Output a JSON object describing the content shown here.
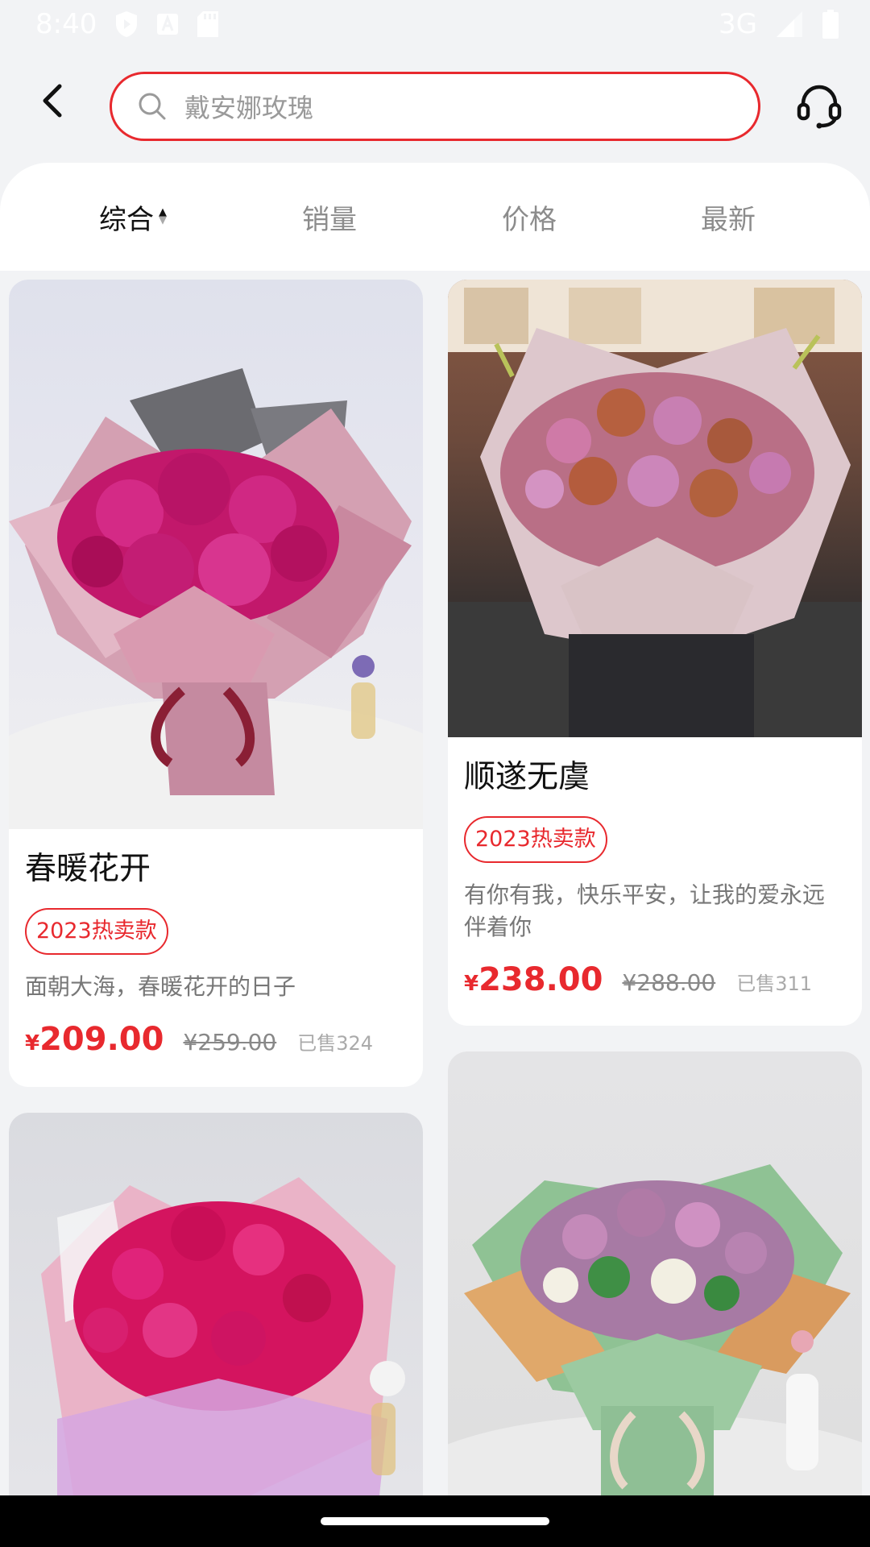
{
  "status_bar": {
    "time": "8:40",
    "network": "3G",
    "icons": [
      "shield-play-icon",
      "font-a-icon",
      "sd-card-icon",
      "signal-icon",
      "battery-icon"
    ]
  },
  "header": {
    "search_placeholder": "戴安娜玫瑰",
    "accent_color": "#e8292e",
    "icons": [
      "back-arrow-icon",
      "search-icon",
      "headset-icon"
    ]
  },
  "sort_tabs": [
    {
      "label": "综合",
      "active": true
    },
    {
      "label": "销量",
      "active": false
    },
    {
      "label": "价格",
      "active": false
    },
    {
      "label": "最新",
      "active": false
    }
  ],
  "products": [
    {
      "title": "春暖花开",
      "tag": "2023热卖款",
      "description": "面朝大海，春暖花开的日子",
      "currency": "¥",
      "price": "209.00",
      "original_price": "¥259.00",
      "sold": "已售324"
    },
    {
      "title": "顺遂无虞",
      "tag": "2023热卖款",
      "description": "有你有我，快乐平安，让我的爱永远伴着你",
      "currency": "¥",
      "price": "238.00",
      "original_price": "¥288.00",
      "sold": "已售311"
    },
    {
      "title": "",
      "tag": "",
      "description": "",
      "currency": "",
      "price": "",
      "original_price": "",
      "sold": ""
    },
    {
      "title": "",
      "tag": "",
      "description": "",
      "currency": "",
      "price": "",
      "original_price": "",
      "sold": ""
    }
  ]
}
